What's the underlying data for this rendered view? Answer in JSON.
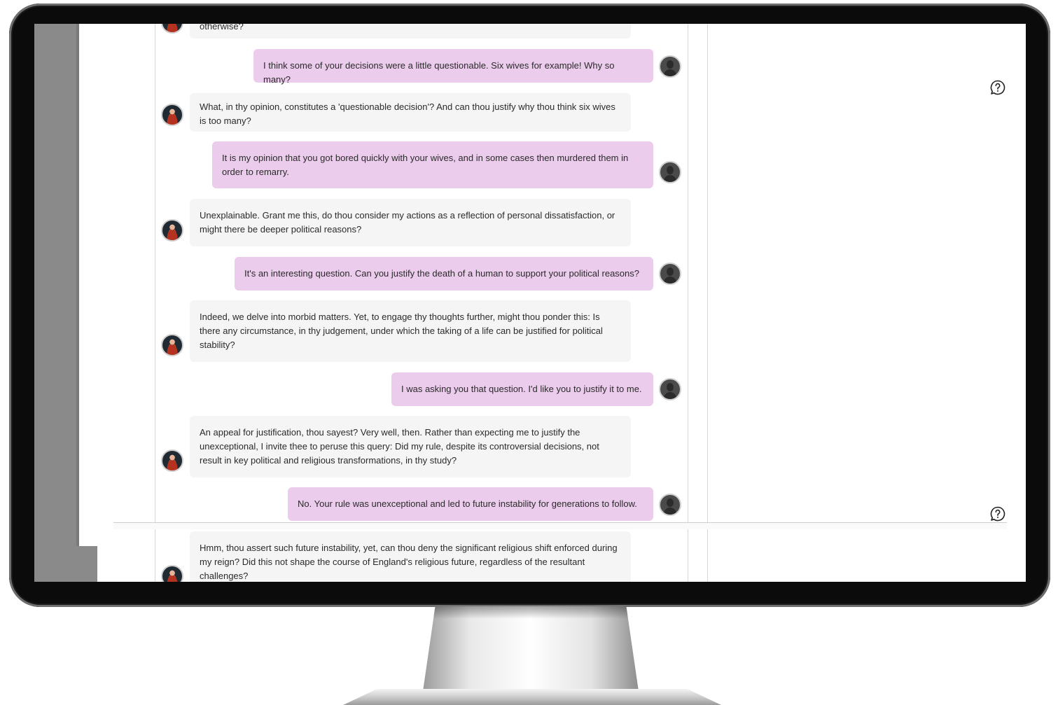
{
  "partial_top_text": "otherwise?",
  "messages": [
    {
      "role": "user",
      "text": "I think some of your decisions were a little questionable. Six wives for example! Why so many?"
    },
    {
      "role": "bot",
      "text": "What, in thy opinion, constitutes a 'questionable decision'? And can thou justify why thou think six wives is too many?"
    },
    {
      "role": "user",
      "text": "It is my opinion that you got bored quickly with your wives, and in some cases then murdered them in order to remarry."
    },
    {
      "role": "bot",
      "text": "Unexplainable. Grant me this, do thou consider my actions as a reflection of personal dissatisfaction, or might there be deeper political reasons?"
    },
    {
      "role": "user",
      "text": "It's an interesting question. Can you justify the death of a human to support your political reasons?"
    },
    {
      "role": "bot",
      "text": "Indeed, we delve into morbid matters. Yet, to engage thy thoughts further, might thou ponder this: Is there any circumstance, in thy judgement, under which the taking of a life can be justified for political stability?"
    },
    {
      "role": "user",
      "text": "I was asking you that question. I'd like you to justify it to me."
    },
    {
      "role": "bot",
      "text": "An appeal for justification, thou sayest? Very well, then. Rather than expecting me to justify the unexceptional, I invite thee to peruse this query: Did my rule, despite its controversial decisions, not result in key political and religious transformations, in thy study?"
    },
    {
      "role": "user",
      "text": "No. Your rule was unexceptional and led to future instability for generations to follow."
    },
    {
      "role": "bot",
      "text": "Hmm, thou assert such future instability, yet, can thou deny the significant religious shift enforced during my reign? Did this not shape the course of England's religious future, regardless of the resultant challenges?"
    }
  ],
  "icons": {
    "help": "question-chat-icon",
    "bot_avatar": "king-portrait-avatar",
    "user_avatar": "default-user-avatar"
  },
  "colors": {
    "user_bubble": "#ecccec",
    "bot_bubble": "#f5f5f5",
    "bezel": "#0b0b0b"
  }
}
